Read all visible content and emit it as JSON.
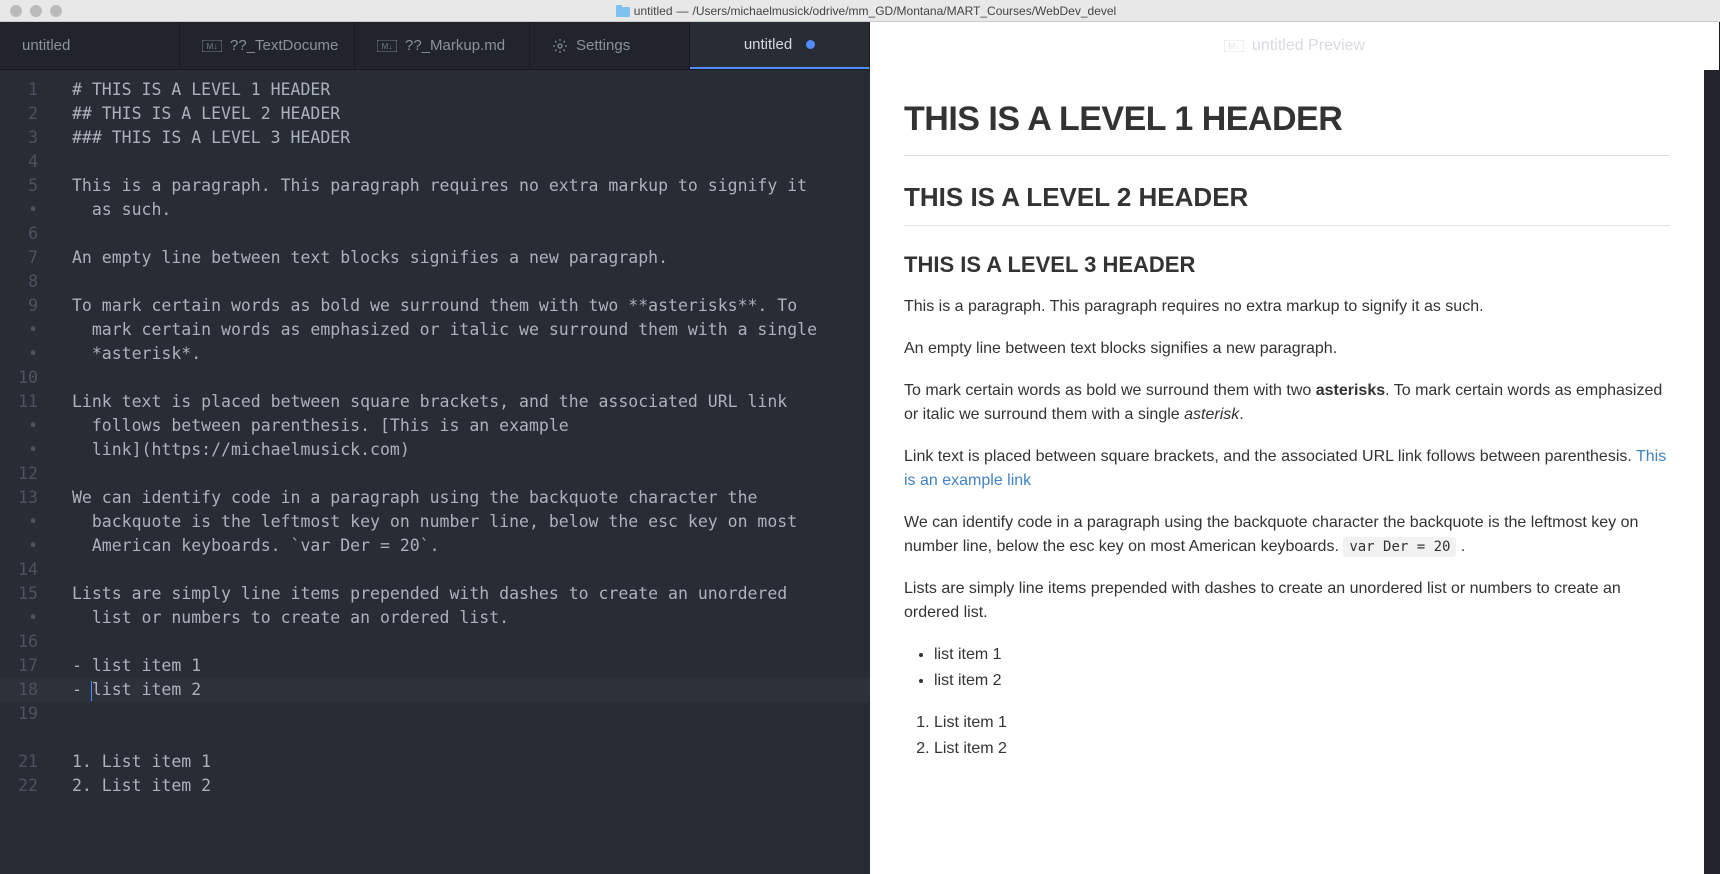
{
  "titlebar": {
    "file": "untitled",
    "sep": " — ",
    "path": "/Users/michaelmusick/odrive/mm_GD/Montana/MART_Courses/WebDev_devel"
  },
  "tabs": [
    {
      "label": "untitled",
      "icon": "",
      "active": false
    },
    {
      "label": "??_TextDocume",
      "icon": "md",
      "active": false
    },
    {
      "label": "??_Markup.md",
      "icon": "md",
      "active": false
    },
    {
      "label": "Settings",
      "icon": "gear",
      "active": false
    },
    {
      "label": "untitled",
      "icon": "",
      "active": true,
      "dirty": true
    }
  ],
  "preview_tab": "untitled Preview",
  "gutter": [
    "1",
    "2",
    "3",
    "4",
    "5",
    "•",
    "6",
    "7",
    "8",
    "9",
    "•",
    "•",
    "10",
    "11",
    "•",
    "•",
    "12",
    "13",
    "•",
    "•",
    "14",
    "15",
    "•",
    "16",
    "17",
    "18",
    "19",
    "",
    "21",
    "22"
  ],
  "editor_lines": [
    "# THIS IS A LEVEL 1 HEADER",
    "## THIS IS A LEVEL 2 HEADER",
    "### THIS IS A LEVEL 3 HEADER",
    "",
    "This is a paragraph. This paragraph requires no extra markup to signify it",
    "  as such.",
    "",
    "An empty line between text blocks signifies a new paragraph.",
    "",
    "To mark certain words as bold we surround them with two **asterisks**. To",
    "  mark certain words as emphasized or italic we surround them with a single",
    "  *asterisk*.",
    "",
    "Link text is placed between square brackets, and the associated URL link",
    "  follows between parenthesis. [This is an example",
    "  link](https://michaelmusick.com)",
    "",
    "We can identify code in a paragraph using the backquote character the",
    "  backquote is the leftmost key on number line, below the esc key on most",
    "  American keyboards. `var Der = 20`.",
    "",
    "Lists are simply line items prepended with dashes to create an unordered",
    "  list or numbers to create an ordered list.",
    "",
    "- list item 1",
    "- list item 2",
    "",
    "",
    "1. List item 1",
    "2. List item 2"
  ],
  "cursor_line_index": 25,
  "preview": {
    "h1": "THIS IS A LEVEL 1 HEADER",
    "h2": "THIS IS A LEVEL 2 HEADER",
    "h3": "THIS IS A LEVEL 3 HEADER",
    "p1": "This is a paragraph. This paragraph requires no extra markup to signify it as such.",
    "p2": "An empty line between text blocks signifies a new paragraph.",
    "p3_a": "To mark certain words as bold we surround them with two ",
    "p3_b": "asterisks",
    "p3_c": ". To mark certain words as emphasized or italic we surround them with a single ",
    "p3_d": "asterisk",
    "p3_e": ".",
    "p4_a": "Link text is placed between square brackets, and the associated URL link follows between parenthesis. ",
    "p4_link": "This is an example link",
    "p5_a": "We can identify code in a paragraph using the backquote character the backquote is the leftmost key on number line, below the esc key on most American keyboards. ",
    "p5_code": "var Der = 20",
    "p5_b": " .",
    "p6": "Lists are simply line items prepended with dashes to create an unordered list or numbers to create an ordered list.",
    "ul": [
      "list item 1",
      "list item 2"
    ],
    "ol": [
      "List item 1",
      "List item 2"
    ]
  }
}
